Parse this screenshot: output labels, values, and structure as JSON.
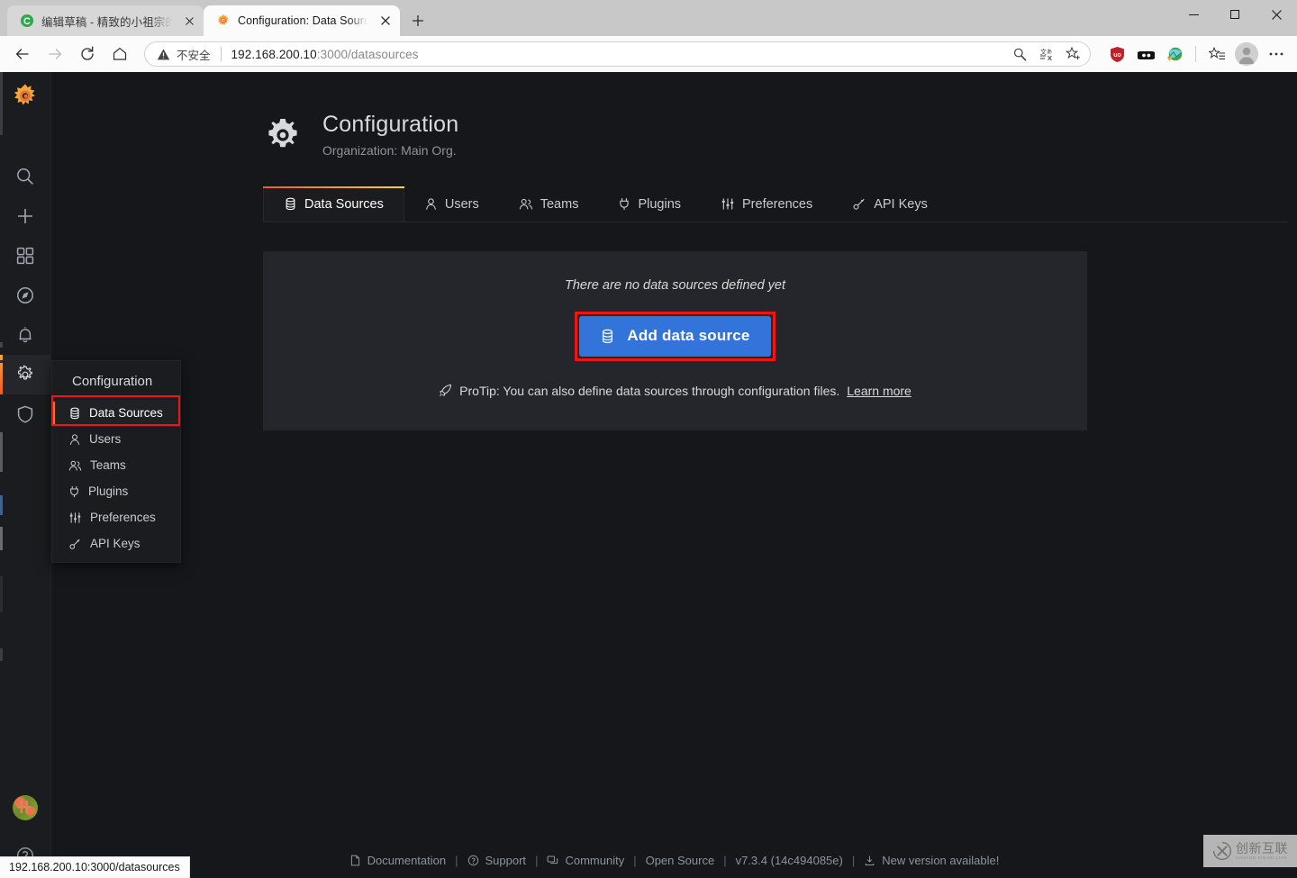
{
  "browser": {
    "tabs": [
      {
        "title": "编辑草稿 - 精致的小祖宗的个人主",
        "favicon": "circle-c-icon",
        "active": false
      },
      {
        "title": "Configuration: Data Sources - Gr",
        "favicon": "grafana-icon",
        "active": true
      }
    ],
    "new_tab_label": "+",
    "window_controls": {
      "minimize": "—",
      "maximize": "□",
      "close": "✕"
    },
    "nav": {
      "back_label": "←",
      "forward_label": "→",
      "reload_label": "⟳",
      "home_label": "⌂"
    },
    "omnibox": {
      "security_label": "不安全",
      "url_host": "192.168.200.10",
      "url_path": ":3000/datasources",
      "full_url": "192.168.200.10:3000/datasources",
      "icons": [
        "search-magnifier-icon",
        "translate-icon",
        "favorite-star-icon"
      ]
    },
    "extensions": [
      "ublock-origin-icon",
      "dark-reader-icon",
      "internet-download-manager-icon"
    ],
    "toolbar_right": [
      "collections-icon",
      "profile-avatar",
      "settings-more-icon"
    ],
    "status_bar_url": "192.168.200.10:3000/datasources"
  },
  "grafana": {
    "sidebar": {
      "logo": "grafana-logo",
      "items": [
        {
          "label": "Search",
          "icon": "search-icon",
          "active": false
        },
        {
          "label": "Create",
          "icon": "plus-icon",
          "active": false
        },
        {
          "label": "Dashboards",
          "icon": "apps-grid-icon",
          "active": false
        },
        {
          "label": "Explore",
          "icon": "compass-icon",
          "active": false
        },
        {
          "label": "Alerting",
          "icon": "bell-icon",
          "active": false
        },
        {
          "label": "Configuration",
          "icon": "gear-icon",
          "active": true
        },
        {
          "label": "Server Admin",
          "icon": "shield-icon",
          "active": false
        }
      ],
      "bottom": [
        {
          "label": "User profile",
          "icon": "user-avatar"
        },
        {
          "label": "Help",
          "icon": "question-circle-icon"
        }
      ]
    },
    "menu": {
      "title": "Configuration",
      "items": [
        {
          "label": "Data Sources",
          "icon": "database-icon",
          "active": true
        },
        {
          "label": "Users",
          "icon": "user-icon",
          "active": false
        },
        {
          "label": "Teams",
          "icon": "users-alt-icon",
          "active": false
        },
        {
          "label": "Plugins",
          "icon": "plug-icon",
          "active": false
        },
        {
          "label": "Preferences",
          "icon": "sliders-icon",
          "active": false
        },
        {
          "label": "API Keys",
          "icon": "key-skeleton-icon",
          "active": false
        }
      ]
    },
    "page": {
      "icon": "gear-icon",
      "title": "Configuration",
      "subtitle": "Organization: Main Org."
    },
    "tabs": [
      {
        "label": "Data Sources",
        "icon": "database-icon",
        "active": true
      },
      {
        "label": "Users",
        "icon": "user-icon",
        "active": false
      },
      {
        "label": "Teams",
        "icon": "users-alt-icon",
        "active": false
      },
      {
        "label": "Plugins",
        "icon": "plug-icon",
        "active": false
      },
      {
        "label": "Preferences",
        "icon": "sliders-icon",
        "active": false
      },
      {
        "label": "API Keys",
        "icon": "key-skeleton-icon",
        "active": false
      }
    ],
    "empty_state": {
      "message": "There are no data sources defined yet",
      "button_label": "Add data source",
      "button_icon": "database-icon",
      "button_color": "#3274d9",
      "protip_icon": "rocket-icon",
      "protip_text": "ProTip: You can also define data sources through configuration files.",
      "protip_link": "Learn more"
    },
    "footer": {
      "items": [
        {
          "label": "Documentation",
          "icon": "document-icon"
        },
        {
          "label": "Support",
          "icon": "question-circle-icon"
        },
        {
          "label": "Community",
          "icon": "comments-icon"
        },
        {
          "label": "Open Source",
          "icon": ""
        },
        {
          "label": "v7.3.4 (14c494085e)",
          "icon": ""
        },
        {
          "label": "New version available!",
          "icon": "download-icon"
        }
      ],
      "separator": "|"
    },
    "accent_color": "#eb7b18",
    "annotation_color": "#f01414"
  },
  "watermark": {
    "cn": "创新互联",
    "en": "CHUANG XIN HU LIAN"
  }
}
